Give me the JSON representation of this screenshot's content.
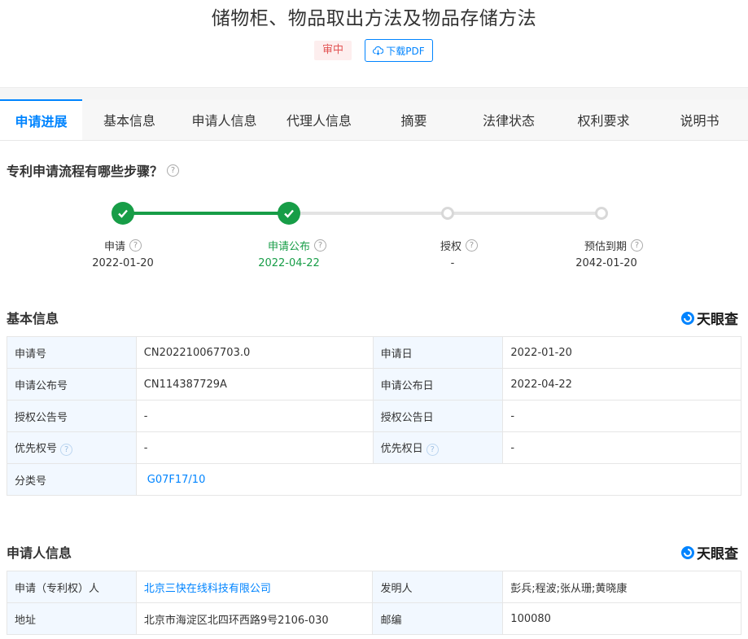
{
  "page": {
    "title": "储物柜、物品取出方法及物品存储方法",
    "status_badge": "审中",
    "download_label": "下载PDF"
  },
  "tabs": [
    {
      "label": "申请进展",
      "active": true
    },
    {
      "label": "基本信息"
    },
    {
      "label": "申请人信息"
    },
    {
      "label": "代理人信息"
    },
    {
      "label": "摘要"
    },
    {
      "label": "法律状态"
    },
    {
      "label": "权利要求"
    },
    {
      "label": "说明书"
    }
  ],
  "process": {
    "question": "专利申请流程有哪些步骤？",
    "steps": [
      {
        "label": "申请",
        "date": "2022-01-20",
        "done": true
      },
      {
        "label": "申请公布",
        "date": "2022-04-22",
        "done": true,
        "current": true
      },
      {
        "label": "授权",
        "date": "-",
        "done": false
      },
      {
        "label": "预估到期",
        "date": "2042-01-20",
        "done": false
      }
    ]
  },
  "basic_info": {
    "title": "基本信息",
    "logo_text": "天眼查",
    "rows": [
      {
        "k1": "申请号",
        "v1": "CN202210067703.0",
        "k2": "申请日",
        "v2": "2022-01-20"
      },
      {
        "k1": "申请公布号",
        "v1": "CN114387729A",
        "k2": "申请公布日",
        "v2": "2022-04-22"
      },
      {
        "k1": "授权公告号",
        "v1": "-",
        "k2": "授权公告日",
        "v2": "-"
      },
      {
        "k1": "优先权号",
        "v1": "-",
        "k2": "优先权日",
        "v2": "-"
      }
    ],
    "class_label": "分类号",
    "class_value": "G07F17/10"
  },
  "applicant_info": {
    "title": "申请人信息",
    "logo_text": "天眼查",
    "applicant_label": "申请（专利权）人",
    "applicant_value": "北京三快在线科技有限公司",
    "inventor_label": "发明人",
    "inventor_value": "彭兵;程波;张从珊;黄晓康",
    "address_label": "地址",
    "address_value": "北京市海淀区北四环西路9号2106-030",
    "postcode_label": "邮编",
    "postcode_value": "100080"
  },
  "colors": {
    "accent": "#0084ff",
    "done": "#179d47",
    "badge_text": "#e25555"
  }
}
